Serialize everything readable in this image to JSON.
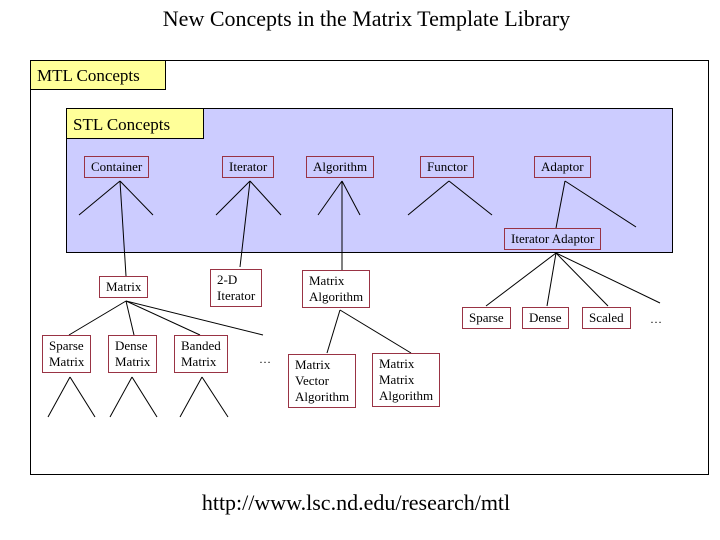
{
  "title": "New Concepts in the Matrix Template Library",
  "url": "http://www.lsc.nd.edu/research/mtl",
  "colors": {
    "concept_label_bg": "#ffff99",
    "stl_region_bg": "#ccccff",
    "node_border": "#993344"
  },
  "mtl_group": {
    "label": "MTL Concepts"
  },
  "stl_group": {
    "label": "STL Concepts",
    "nodes": [
      {
        "id": "container",
        "label": "Container"
      },
      {
        "id": "iterator",
        "label": "Iterator"
      },
      {
        "id": "algorithm",
        "label": "Algorithm"
      },
      {
        "id": "functor",
        "label": "Functor"
      },
      {
        "id": "adaptor",
        "label": "Adaptor"
      },
      {
        "id": "iterator_adaptor",
        "label": "Iterator Adaptor"
      }
    ]
  },
  "mtl_nodes": [
    {
      "id": "matrix",
      "label": "Matrix",
      "parent": "container"
    },
    {
      "id": "iter_2d",
      "label": "2-D Iterator",
      "line1": "2-D",
      "line2": "Iterator",
      "parent": "iterator"
    },
    {
      "id": "matrix_algorithm",
      "label": "Matrix Algorithm",
      "line1": "Matrix",
      "line2": "Algorithm",
      "parent": "algorithm"
    },
    {
      "id": "sparse",
      "label": "Sparse",
      "parent": "iterator_adaptor"
    },
    {
      "id": "dense",
      "label": "Dense",
      "parent": "iterator_adaptor"
    },
    {
      "id": "scaled",
      "label": "Scaled",
      "parent": "iterator_adaptor"
    },
    {
      "id": "sparse_matrix",
      "label": "Sparse Matrix",
      "line1": "Sparse",
      "line2": "Matrix",
      "parent": "matrix"
    },
    {
      "id": "dense_matrix",
      "label": "Dense Matrix",
      "line1": "Dense",
      "line2": "Matrix",
      "parent": "matrix"
    },
    {
      "id": "banded_matrix",
      "label": "Banded Matrix",
      "line1": "Banded",
      "line2": "Matrix",
      "parent": "matrix"
    },
    {
      "id": "mv_algorithm",
      "label": "Matrix Vector Algorithm",
      "line1": "Matrix",
      "line2": "Vector",
      "line3": "Algorithm",
      "parent": "matrix_algorithm"
    },
    {
      "id": "mm_algorithm",
      "label": "Matrix Matrix Algorithm",
      "line1": "Matrix",
      "line2": "Matrix",
      "line3": "Algorithm",
      "parent": "matrix_algorithm"
    }
  ],
  "ellipses": {
    "matrix_more": "…",
    "adaptor_more": "…"
  }
}
